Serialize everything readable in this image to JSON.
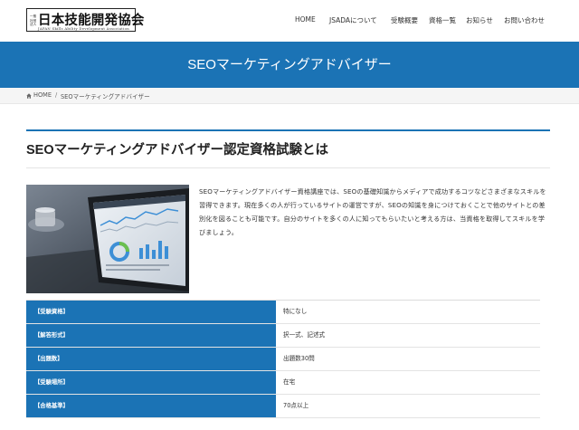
{
  "header": {
    "logo": {
      "small": "一般社団法人",
      "title": "日本技能開発協会",
      "subtitle": "JAPAN Skills Ability Development Association"
    },
    "nav": [
      "HOME",
      "JSADAについて",
      "受験概要",
      "資格一覧",
      "お知らせ",
      "お問い合わせ"
    ]
  },
  "banner": {
    "title": "SEOマーケティングアドバイザー"
  },
  "breadcrumb": {
    "home": "HOME",
    "separator": "/",
    "current": "SEOマーケティングアドバイザー"
  },
  "section": {
    "title": "SEOマーケティングアドバイザー認定資格試験とは"
  },
  "description": "SEOマーケティングアドバイザー資格講座では、SEOの基礎知識からメディアで成功するコツなどさまざまなスキルを習得できます。現在多くの人が行っているサイトの運営ですが、SEOの知識を身につけておくことで他のサイトとの差別化を図ることも可能です。自分のサイトを多くの人に知ってもらいたいと考える方は、当資格を取得してスキルを学びましょう。",
  "table": [
    {
      "label": "【受験資格】",
      "value": "特になし"
    },
    {
      "label": "【解答形式】",
      "value": "択一式、記述式"
    },
    {
      "label": "【出題数】",
      "value": "出題数30問"
    },
    {
      "label": "【受験場所】",
      "value": "在宅"
    },
    {
      "label": "【合格基準】",
      "value": "70点以上"
    }
  ],
  "colors": {
    "accent": "#1b73b5",
    "breadcrumb_bg": "#f5f5f5",
    "text": "#333333"
  }
}
